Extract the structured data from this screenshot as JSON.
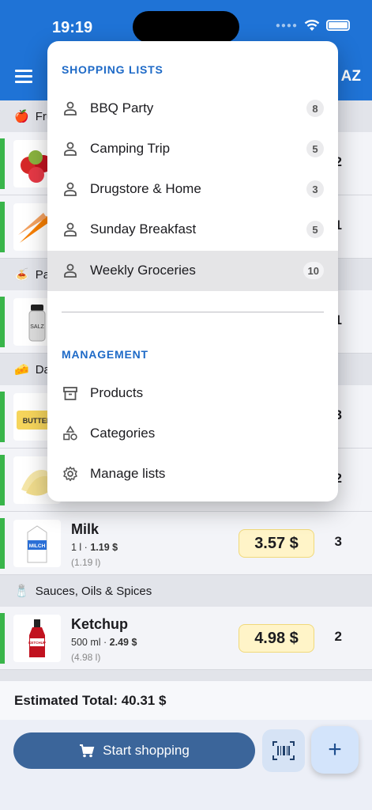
{
  "status": {
    "time": "19:19"
  },
  "toolbar": {
    "sort_icon": "sort-az-icon",
    "sort_text": "AZ"
  },
  "categories": [
    {
      "emoji": "🍎",
      "label": "Fru"
    },
    {
      "emoji": "🍝",
      "label": "Pa"
    },
    {
      "emoji": "🧀",
      "label": "Da"
    },
    {
      "emoji": "🧂",
      "label": "Sauces, Oils & Spices"
    }
  ],
  "hidden_qty": [
    "2",
    "1",
    "1",
    "3",
    "2"
  ],
  "items": [
    {
      "name": "Milk",
      "size": "1 l · ",
      "unit_price": "1.19 $",
      "per_unit": "(1.19 l)",
      "price": "3.57 $",
      "qty": "3",
      "thumb_text": "MILCH"
    },
    {
      "name": "Ketchup",
      "size": "500 ml · ",
      "unit_price": "2.49 $",
      "per_unit": "(4.98 l)",
      "price": "4.98 $",
      "qty": "2",
      "thumb_text": "KETCHUP"
    }
  ],
  "thumbs": {
    "salt": "SALZ",
    "butter": "BUTTER"
  },
  "total": {
    "label": "Estimated Total: 40.31 $"
  },
  "bottom": {
    "start_label": "Start shopping",
    "add_label": "+"
  },
  "menu": {
    "lists_header": "SHOPPING LISTS",
    "lists": [
      {
        "label": "BBQ Party",
        "count": "8"
      },
      {
        "label": "Camping Trip",
        "count": "5"
      },
      {
        "label": "Drugstore & Home",
        "count": "3"
      },
      {
        "label": "Sunday Breakfast",
        "count": "5"
      },
      {
        "label": "Weekly Groceries",
        "count": "10",
        "selected": true
      }
    ],
    "management_header": "MANAGEMENT",
    "management": [
      {
        "label": "Products",
        "icon": "archive-icon"
      },
      {
        "label": "Categories",
        "icon": "shapes-icon"
      },
      {
        "label": "Manage lists",
        "icon": "gear-icon"
      }
    ]
  },
  "colors": {
    "appbar": "#1f73d6",
    "accent": "#1e6ac7",
    "in_cart_bar": "#39b54a",
    "price_bg": "#fff4c8",
    "start_button": "#3b659a"
  }
}
